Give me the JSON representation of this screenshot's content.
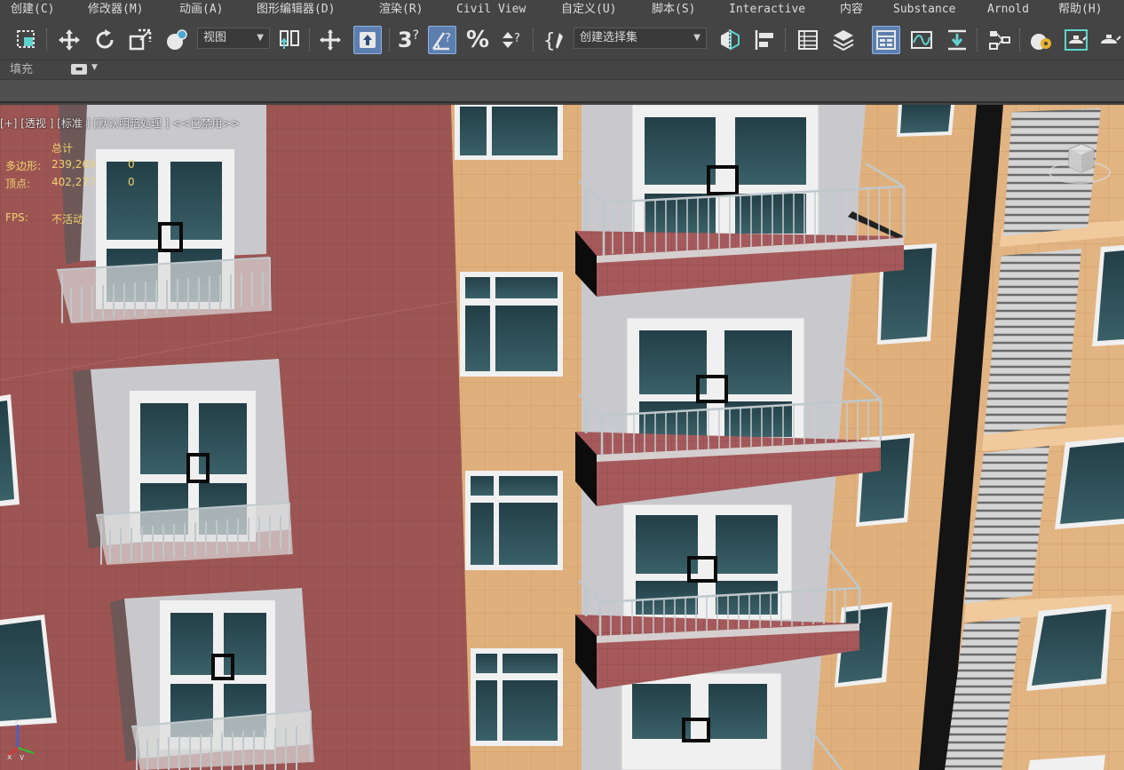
{
  "menubar": {
    "items": [
      {
        "label": "创建(C)"
      },
      {
        "label": "修改器(M)"
      },
      {
        "label": "动画(A)"
      },
      {
        "label": "图形编辑器(D)"
      },
      {
        "label": "渲染(R)"
      },
      {
        "label": "Civil View"
      },
      {
        "label": "自定义(U)"
      },
      {
        "label": "脚本(S)"
      },
      {
        "label": "Interactive"
      },
      {
        "label": "内容"
      },
      {
        "label": "Substance"
      },
      {
        "label": "Arnold"
      },
      {
        "label": "帮助(H)"
      }
    ]
  },
  "toolbar": {
    "icons": {
      "select_region": "select-region-icon",
      "move": "move-icon",
      "rotate": "rotate-icon",
      "scale": "scale-icon",
      "place": "place-icon",
      "snap3": "snaps-toggle-icon",
      "angle_snap": "angle-snap-icon",
      "percent_snap": "percent-snap-icon",
      "spinner_snap": "spinner-snap-icon",
      "named_sets": "edit-named-selection-icon",
      "mirror": "mirror-icon",
      "align": "align-icon",
      "layer_explorer": "layer-explorer-icon",
      "layers": "toggle-layers-icon",
      "ribbon": "toggle-ribbon-icon",
      "curve_editor": "curve-editor-icon",
      "dope_sheet": "dope-sheet-icon",
      "schematic": "schematic-view-icon",
      "material_editor": "material-editor-icon",
      "render_setup": "render-setup-icon",
      "rendered_frame": "rendered-frame-window-icon",
      "render": "render-production-icon"
    },
    "reference_coord": "视图",
    "selection_set_placeholder": "创建选择集",
    "snap_label": "3"
  },
  "ribbon": {
    "fill_label": "填充"
  },
  "viewport": {
    "label": "[+] [透视 ] [标准 ] [默认明暗处理 ] <<已禁用>>",
    "stats": {
      "header": "总计",
      "polys_label": "多边形:",
      "polys_value": "239,269",
      "polys_sel": "0",
      "verts_label": "顶点:",
      "verts_value": "402,277",
      "verts_sel": "0",
      "fps_label": "FPS:",
      "fps_value": "不活动"
    },
    "axis": {
      "x": "x",
      "y": "y",
      "z": "z"
    },
    "colors": {
      "red_wall": "#9c5553",
      "tan_wall": "#e0b07c",
      "gray_wall": "#c8c8cc",
      "glass": "#2a4850",
      "frame": "#f0f0f0",
      "slab": "#a5595a",
      "vent": "#cfcfcf"
    }
  }
}
